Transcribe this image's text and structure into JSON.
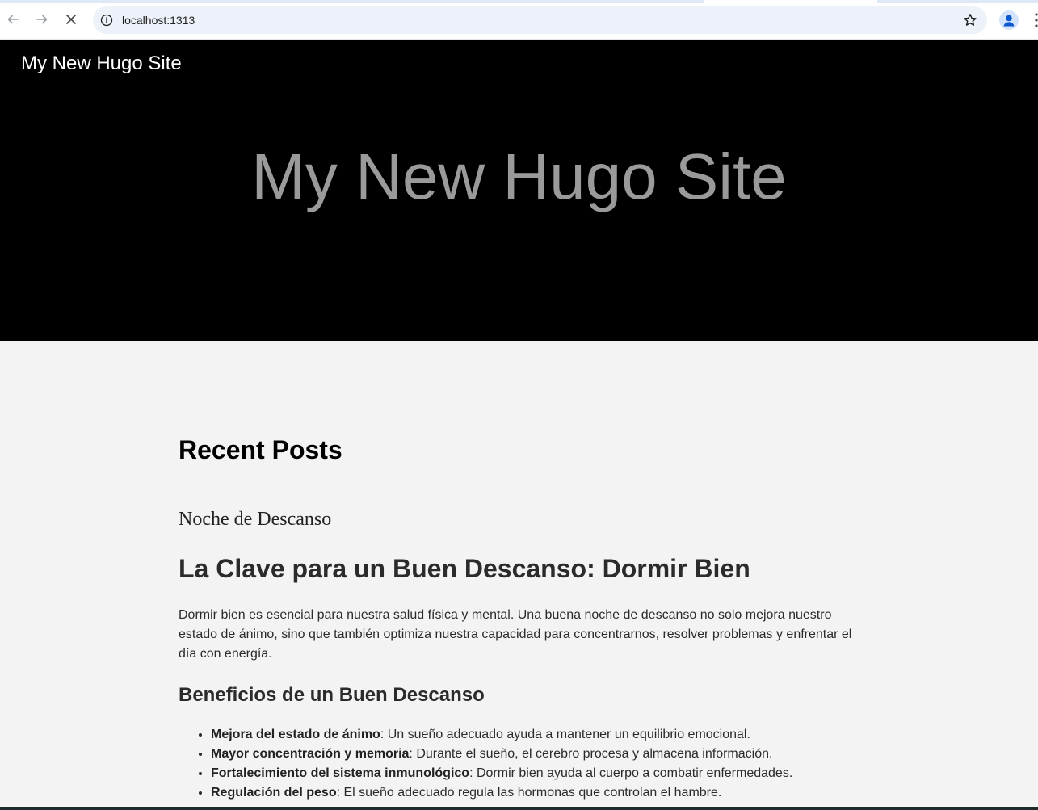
{
  "browser": {
    "url": "localhost:1313",
    "icons": [
      "back-arrow-icon",
      "forward-arrow-icon",
      "stop-loading-icon",
      "site-info-icon",
      "bookmark-star-icon",
      "profile-icon"
    ]
  },
  "site": {
    "brand": "My New Hugo Site",
    "hero_title": "My New Hugo Site"
  },
  "main": {
    "section_title": "Recent Posts",
    "post": {
      "link_title": "Noche de Descanso",
      "heading": "La Clave para un Buen Descanso: Dormir Bien",
      "intro": "Dormir bien es esencial para nuestra salud física y mental. Una buena noche de descanso no solo mejora nuestro estado de ánimo, sino que también optimiza nuestra capacidad para concentrarnos, resolver problemas y enfrentar el día con energía.",
      "subheading": "Beneficios de un Buen Descanso",
      "benefits": [
        {
          "term": "Mejora del estado de ánimo",
          "text": ": Un sueño adecuado ayuda a mantener un equilibrio emocional."
        },
        {
          "term": "Mayor concentración y memoria",
          "text": ": Durante el sueño, el cerebro procesa y almacena información."
        },
        {
          "term": "Fortalecimiento del sistema inmunológico",
          "text": ": Dormir bien ayuda al cuerpo a combatir enfermedades."
        },
        {
          "term": "Regulación del peso",
          "text": ": El sueño adecuado regula las hormonas que controlan el hambre."
        }
      ]
    }
  },
  "colors": {
    "header_bg": "#000000",
    "hero_text": "#9a9a9a",
    "page_bg": "#f3f3f3",
    "omnibox_bg": "#edf2fa"
  }
}
